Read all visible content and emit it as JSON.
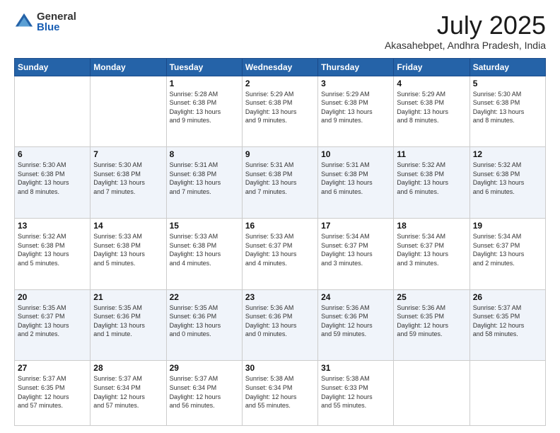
{
  "header": {
    "logo_general": "General",
    "logo_blue": "Blue",
    "month_year": "July 2025",
    "location": "Akasahebpet, Andhra Pradesh, India"
  },
  "weekdays": [
    "Sunday",
    "Monday",
    "Tuesday",
    "Wednesday",
    "Thursday",
    "Friday",
    "Saturday"
  ],
  "weeks": [
    [
      {
        "day": "",
        "info": ""
      },
      {
        "day": "",
        "info": ""
      },
      {
        "day": "1",
        "info": "Sunrise: 5:28 AM\nSunset: 6:38 PM\nDaylight: 13 hours\nand 9 minutes."
      },
      {
        "day": "2",
        "info": "Sunrise: 5:29 AM\nSunset: 6:38 PM\nDaylight: 13 hours\nand 9 minutes."
      },
      {
        "day": "3",
        "info": "Sunrise: 5:29 AM\nSunset: 6:38 PM\nDaylight: 13 hours\nand 9 minutes."
      },
      {
        "day": "4",
        "info": "Sunrise: 5:29 AM\nSunset: 6:38 PM\nDaylight: 13 hours\nand 8 minutes."
      },
      {
        "day": "5",
        "info": "Sunrise: 5:30 AM\nSunset: 6:38 PM\nDaylight: 13 hours\nand 8 minutes."
      }
    ],
    [
      {
        "day": "6",
        "info": "Sunrise: 5:30 AM\nSunset: 6:38 PM\nDaylight: 13 hours\nand 8 minutes."
      },
      {
        "day": "7",
        "info": "Sunrise: 5:30 AM\nSunset: 6:38 PM\nDaylight: 13 hours\nand 7 minutes."
      },
      {
        "day": "8",
        "info": "Sunrise: 5:31 AM\nSunset: 6:38 PM\nDaylight: 13 hours\nand 7 minutes."
      },
      {
        "day": "9",
        "info": "Sunrise: 5:31 AM\nSunset: 6:38 PM\nDaylight: 13 hours\nand 7 minutes."
      },
      {
        "day": "10",
        "info": "Sunrise: 5:31 AM\nSunset: 6:38 PM\nDaylight: 13 hours\nand 6 minutes."
      },
      {
        "day": "11",
        "info": "Sunrise: 5:32 AM\nSunset: 6:38 PM\nDaylight: 13 hours\nand 6 minutes."
      },
      {
        "day": "12",
        "info": "Sunrise: 5:32 AM\nSunset: 6:38 PM\nDaylight: 13 hours\nand 6 minutes."
      }
    ],
    [
      {
        "day": "13",
        "info": "Sunrise: 5:32 AM\nSunset: 6:38 PM\nDaylight: 13 hours\nand 5 minutes."
      },
      {
        "day": "14",
        "info": "Sunrise: 5:33 AM\nSunset: 6:38 PM\nDaylight: 13 hours\nand 5 minutes."
      },
      {
        "day": "15",
        "info": "Sunrise: 5:33 AM\nSunset: 6:38 PM\nDaylight: 13 hours\nand 4 minutes."
      },
      {
        "day": "16",
        "info": "Sunrise: 5:33 AM\nSunset: 6:37 PM\nDaylight: 13 hours\nand 4 minutes."
      },
      {
        "day": "17",
        "info": "Sunrise: 5:34 AM\nSunset: 6:37 PM\nDaylight: 13 hours\nand 3 minutes."
      },
      {
        "day": "18",
        "info": "Sunrise: 5:34 AM\nSunset: 6:37 PM\nDaylight: 13 hours\nand 3 minutes."
      },
      {
        "day": "19",
        "info": "Sunrise: 5:34 AM\nSunset: 6:37 PM\nDaylight: 13 hours\nand 2 minutes."
      }
    ],
    [
      {
        "day": "20",
        "info": "Sunrise: 5:35 AM\nSunset: 6:37 PM\nDaylight: 13 hours\nand 2 minutes."
      },
      {
        "day": "21",
        "info": "Sunrise: 5:35 AM\nSunset: 6:36 PM\nDaylight: 13 hours\nand 1 minute."
      },
      {
        "day": "22",
        "info": "Sunrise: 5:35 AM\nSunset: 6:36 PM\nDaylight: 13 hours\nand 0 minutes."
      },
      {
        "day": "23",
        "info": "Sunrise: 5:36 AM\nSunset: 6:36 PM\nDaylight: 13 hours\nand 0 minutes."
      },
      {
        "day": "24",
        "info": "Sunrise: 5:36 AM\nSunset: 6:36 PM\nDaylight: 12 hours\nand 59 minutes."
      },
      {
        "day": "25",
        "info": "Sunrise: 5:36 AM\nSunset: 6:35 PM\nDaylight: 12 hours\nand 59 minutes."
      },
      {
        "day": "26",
        "info": "Sunrise: 5:37 AM\nSunset: 6:35 PM\nDaylight: 12 hours\nand 58 minutes."
      }
    ],
    [
      {
        "day": "27",
        "info": "Sunrise: 5:37 AM\nSunset: 6:35 PM\nDaylight: 12 hours\nand 57 minutes."
      },
      {
        "day": "28",
        "info": "Sunrise: 5:37 AM\nSunset: 6:34 PM\nDaylight: 12 hours\nand 57 minutes."
      },
      {
        "day": "29",
        "info": "Sunrise: 5:37 AM\nSunset: 6:34 PM\nDaylight: 12 hours\nand 56 minutes."
      },
      {
        "day": "30",
        "info": "Sunrise: 5:38 AM\nSunset: 6:34 PM\nDaylight: 12 hours\nand 55 minutes."
      },
      {
        "day": "31",
        "info": "Sunrise: 5:38 AM\nSunset: 6:33 PM\nDaylight: 12 hours\nand 55 minutes."
      },
      {
        "day": "",
        "info": ""
      },
      {
        "day": "",
        "info": ""
      }
    ]
  ]
}
